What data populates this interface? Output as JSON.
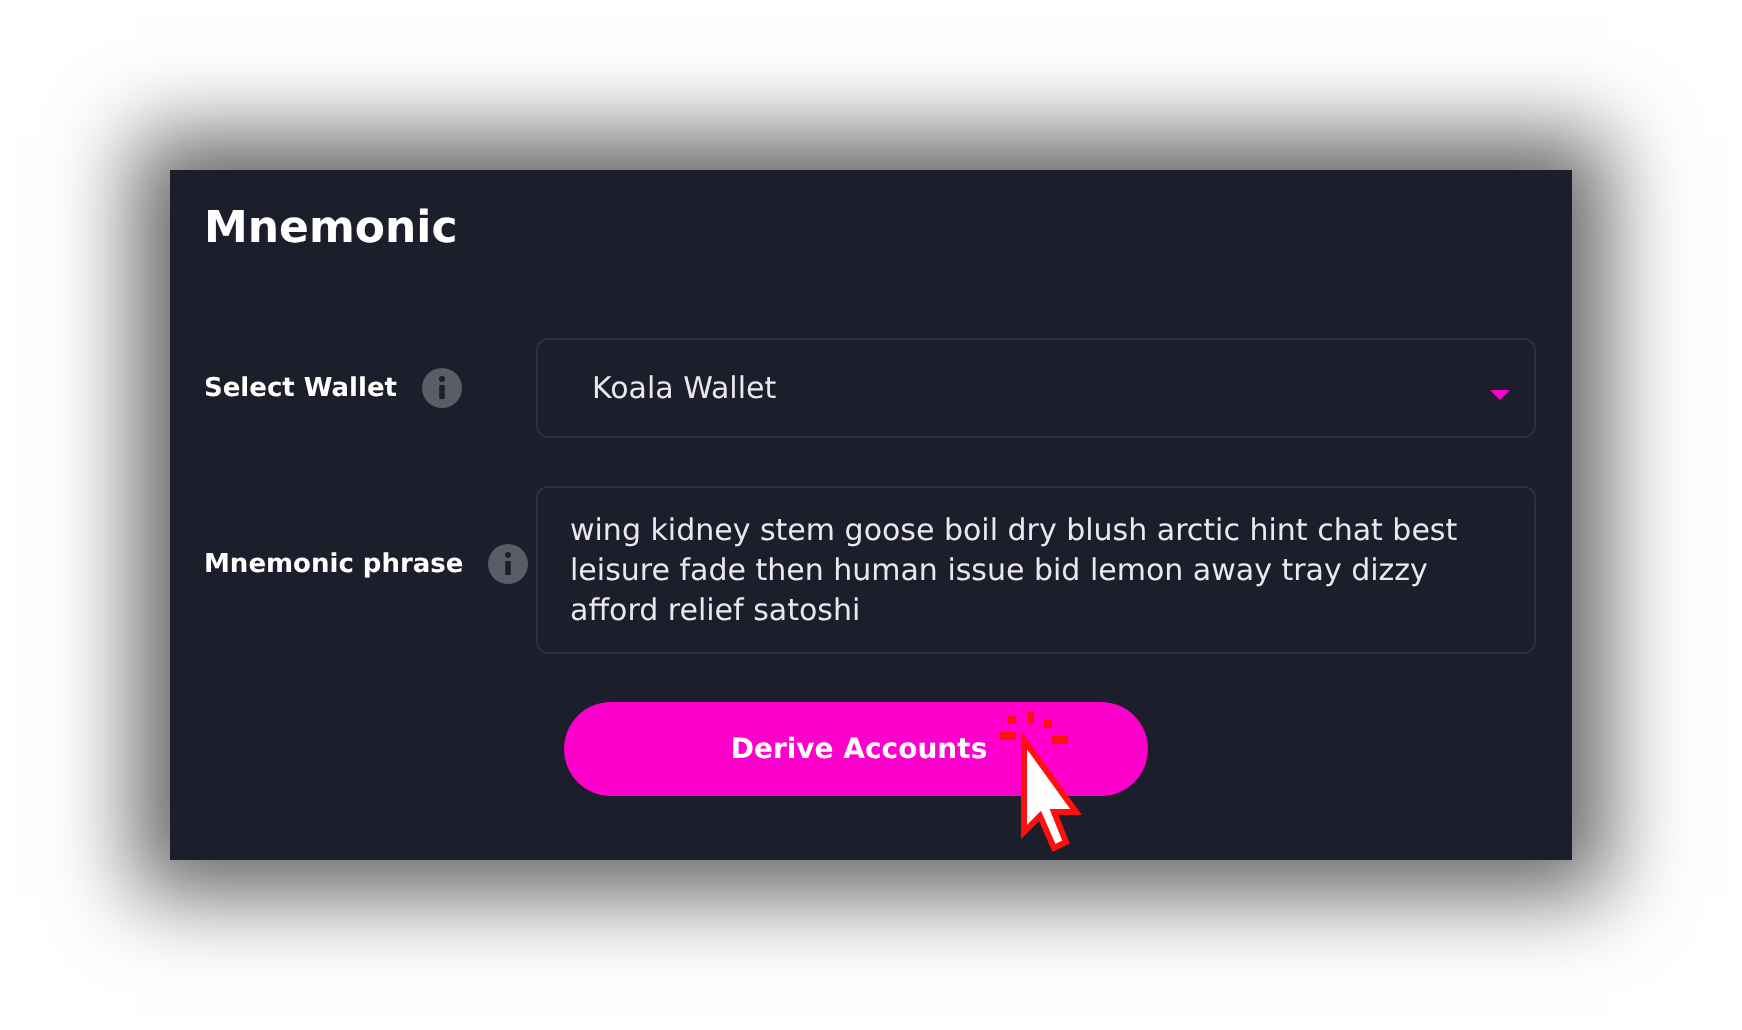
{
  "panel": {
    "title": "Mnemonic"
  },
  "fields": [
    {
      "kind": "select",
      "label": "Select Wallet",
      "value": "Koala Wallet"
    },
    {
      "kind": "textarea",
      "label": "Mnemonic phrase",
      "value": "wing kidney stem goose boil dry blush arctic hint chat best leisure fade then human issue bid lemon away tray dizzy afford relief satoshi"
    }
  ],
  "button": {
    "label": "Derive Accounts"
  }
}
